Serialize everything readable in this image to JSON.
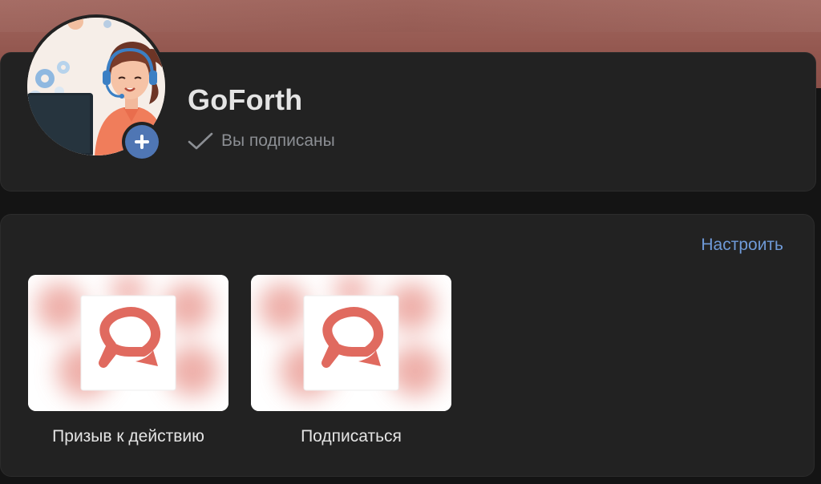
{
  "community": {
    "name": "GoForth",
    "status": "Вы подписаны"
  },
  "actions": {
    "configure_label": "Настроить",
    "tiles": [
      {
        "label": "Призыв к действию"
      },
      {
        "label": "Подписаться"
      }
    ]
  },
  "colors": {
    "accent": "#6f9ad8",
    "badge": "#4f76b4",
    "logo": "#e06a5f",
    "cover": "#9a5e56",
    "card": "#222222"
  }
}
